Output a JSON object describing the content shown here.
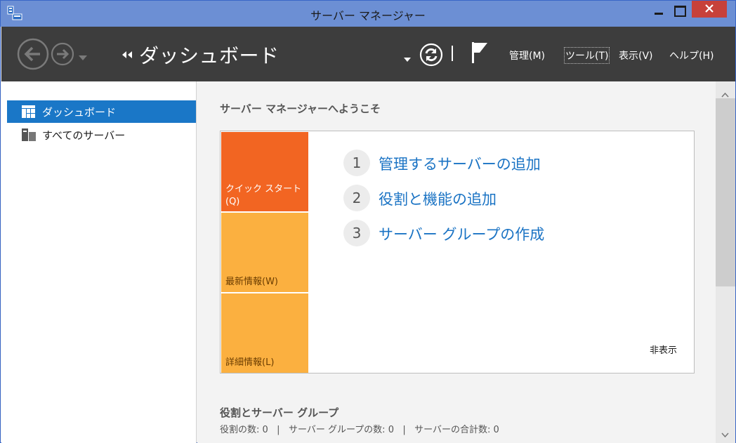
{
  "window": {
    "title": "サーバー マネージャー"
  },
  "header": {
    "page_title": "ダッシュボード",
    "menu": {
      "manage": "管理(M)",
      "tools": "ツール(T)",
      "view": "表示(V)",
      "help": "ヘルプ(H)"
    }
  },
  "sidebar": {
    "items": [
      {
        "label": "ダッシュボード",
        "selected": true
      },
      {
        "label": "すべてのサーバー",
        "selected": false
      }
    ]
  },
  "main": {
    "welcome": "サーバー マネージャーへようこそ",
    "tiles": {
      "quick_start_line1": "クイック スタート",
      "quick_start_line2": "(Q)",
      "whats_new": "最新情報(W)",
      "learn_more": "詳細情報(L)"
    },
    "steps": [
      {
        "num": "1",
        "label": "管理するサーバーの追加"
      },
      {
        "num": "2",
        "label": "役割と機能の追加"
      },
      {
        "num": "3",
        "label": "サーバー グループの作成"
      }
    ],
    "hide": "非表示",
    "roles_title": "役割とサーバー グループ",
    "roles_counts": "役割の数: 0   |   サーバー グループの数: 0   |   サーバーの合計数: 0"
  },
  "colors": {
    "titlebar": "#6c8fd4",
    "header": "#3d3d3d",
    "selected": "#1a77c7",
    "quick_start_tile": "#f26522",
    "info_tiles": "#fbb040",
    "link": "#1a73c4",
    "close_button": "#c7413a"
  }
}
